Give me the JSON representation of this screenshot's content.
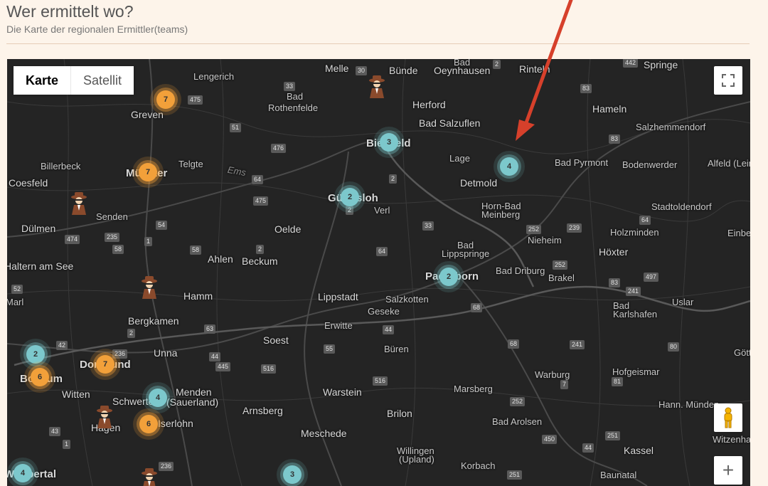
{
  "header": {
    "title": "Wer ermittelt wo?",
    "subtitle": "Die Karte der regionalen Ermittler(teams)"
  },
  "map_controls": {
    "map_type": [
      "Karte",
      "Satellit"
    ],
    "selected": "Karte",
    "zoom_in": "+"
  },
  "places": [
    {
      "name": "Lengerich"
    },
    {
      "name": "Melle"
    },
    {
      "name": "Bünde"
    },
    {
      "name": "Bad"
    },
    {
      "name": "Oeynhausen"
    },
    {
      "name": "Rinteln"
    },
    {
      "name": "Springe"
    },
    {
      "name": "Greven"
    },
    {
      "name": "Bad"
    },
    {
      "name": "Rothenfelde"
    },
    {
      "name": "Herford"
    },
    {
      "name": "Hameln"
    },
    {
      "name": "Bad Salzuflen"
    },
    {
      "name": "Salzhemmendorf"
    },
    {
      "name": "Bielefeld"
    },
    {
      "name": "Lage"
    },
    {
      "name": "Billerbeck"
    },
    {
      "name": "Münster"
    },
    {
      "name": "Telgte"
    },
    {
      "name": "Ems"
    },
    {
      "name": "Bad Pyrmont"
    },
    {
      "name": "Bodenwerder"
    },
    {
      "name": "Alfeld (Leine)"
    },
    {
      "name": "Coesfeld"
    },
    {
      "name": "Detmold"
    },
    {
      "name": "Gütersloh"
    },
    {
      "name": "Verl"
    },
    {
      "name": "Senden"
    },
    {
      "name": "Horn-Bad"
    },
    {
      "name": "Meinberg"
    },
    {
      "name": "Stadtoldendorf"
    },
    {
      "name": "Dülmen"
    },
    {
      "name": "Oelde"
    },
    {
      "name": "Holzminden"
    },
    {
      "name": "Einbeck"
    },
    {
      "name": "Nieheim"
    },
    {
      "name": "Bad"
    },
    {
      "name": "Lippspringe"
    },
    {
      "name": "Höxter"
    },
    {
      "name": "Ahlen"
    },
    {
      "name": "Beckum"
    },
    {
      "name": "Haltern am See"
    },
    {
      "name": "Paderborn"
    },
    {
      "name": "Bad Driburg"
    },
    {
      "name": "Brakel"
    },
    {
      "name": "Hamm"
    },
    {
      "name": "Lippstadt"
    },
    {
      "name": "Salzkotten"
    },
    {
      "name": "Marl"
    },
    {
      "name": "Uslar"
    },
    {
      "name": "Bad"
    },
    {
      "name": "Karlshafen"
    },
    {
      "name": "Geseke"
    },
    {
      "name": "Bergkamen"
    },
    {
      "name": "Erwitte"
    },
    {
      "name": "Soest"
    },
    {
      "name": "Unna"
    },
    {
      "name": "Büren"
    },
    {
      "name": "Göttingen"
    },
    {
      "name": "Dortmund"
    },
    {
      "name": "Warburg"
    },
    {
      "name": "Hofgeismar"
    },
    {
      "name": "Bochum"
    },
    {
      "name": "Witten"
    },
    {
      "name": "Warstein"
    },
    {
      "name": "Marsberg"
    },
    {
      "name": "Schwerte"
    },
    {
      "name": "Menden"
    },
    {
      "name": "(Sauerland)"
    },
    {
      "name": "Hann. Münden"
    },
    {
      "name": "Arnsberg"
    },
    {
      "name": "Brilon"
    },
    {
      "name": "Iserlohn"
    },
    {
      "name": "Hagen"
    },
    {
      "name": "Bad Arolsen"
    },
    {
      "name": "Witzenhausen"
    },
    {
      "name": "Meschede"
    },
    {
      "name": "Willingen"
    },
    {
      "name": "(Upland)"
    },
    {
      "name": "Kassel"
    },
    {
      "name": "Korbach"
    },
    {
      "name": "Baunatal"
    },
    {
      "name": "Wuppertal"
    }
  ],
  "road_shields": [
    "30",
    "2",
    "442",
    "33",
    "83",
    "475",
    "51",
    "476",
    "83",
    "64",
    "2",
    "475",
    "33",
    "474",
    "235",
    "54",
    "239",
    "252",
    "64",
    "58",
    "1",
    "58",
    "2",
    "64",
    "252",
    "497",
    "83",
    "52",
    "241",
    "63",
    "68",
    "2",
    "42",
    "236",
    "44",
    "44",
    "55",
    "241",
    "80",
    "445",
    "516",
    "68",
    "7",
    "81",
    "516",
    "252",
    "43",
    "1",
    "450",
    "251",
    "44",
    "236",
    "251",
    "2"
  ],
  "clusters": [
    {
      "count": "7",
      "color": "orange"
    },
    {
      "count": "3",
      "color": "teal"
    },
    {
      "count": "7",
      "color": "orange"
    },
    {
      "count": "4",
      "color": "teal"
    },
    {
      "count": "2",
      "color": "teal"
    },
    {
      "count": "2",
      "color": "teal"
    },
    {
      "count": "2",
      "color": "teal"
    },
    {
      "count": "7",
      "color": "orange"
    },
    {
      "count": "6",
      "color": "orange"
    },
    {
      "count": "4",
      "color": "teal"
    },
    {
      "count": "6",
      "color": "orange"
    },
    {
      "count": "4",
      "color": "teal"
    },
    {
      "count": "3",
      "color": "teal"
    }
  ],
  "colors": {
    "map_background": "#242424",
    "cluster_teal": "#7cc8cc",
    "cluster_orange": "#f2a03a",
    "annotation_arrow": "#d6402b"
  }
}
